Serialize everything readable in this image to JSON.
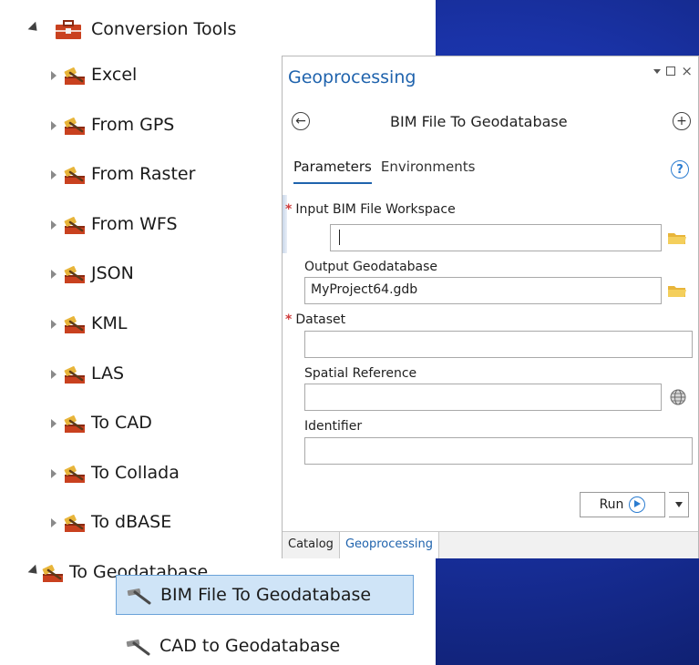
{
  "tree": {
    "root": {
      "label": "Conversion Tools"
    },
    "toolsets": [
      {
        "label": "Excel"
      },
      {
        "label": "From GPS"
      },
      {
        "label": "From Raster"
      },
      {
        "label": "From WFS"
      },
      {
        "label": "JSON"
      },
      {
        "label": "KML"
      },
      {
        "label": "LAS"
      },
      {
        "label": "To CAD"
      },
      {
        "label": "To Collada"
      },
      {
        "label": "To dBASE"
      },
      {
        "label": "To Geodatabase"
      }
    ],
    "tools": [
      {
        "label": "BIM File To Geodatabase",
        "selected": true
      },
      {
        "label": "CAD to Geodatabase",
        "selected": false
      }
    ]
  },
  "pane": {
    "title": "Geoprocessing",
    "tool_name": "BIM File To Geodatabase",
    "tabs": [
      {
        "label": "Parameters",
        "active": true
      },
      {
        "label": "Environments",
        "active": false
      }
    ],
    "params": {
      "input_bim": {
        "label": "Input BIM File Workspace",
        "value": "",
        "required": true
      },
      "output_gdb": {
        "label": "Output Geodatabase",
        "value": "MyProject64.gdb",
        "required": false
      },
      "dataset": {
        "label": "Dataset",
        "value": "",
        "required": true
      },
      "spatial_ref": {
        "label": "Spatial Reference",
        "value": "",
        "required": false
      },
      "identifier": {
        "label": "Identifier",
        "value": "",
        "required": false
      }
    },
    "run_label": "Run",
    "bottom_tabs": [
      {
        "label": "Catalog",
        "active": false
      },
      {
        "label": "Geoprocessing",
        "active": true
      }
    ]
  },
  "colors": {
    "accent": "#1f63ad",
    "required": "#d03c3c",
    "background": "#1a33a8",
    "selection": "#cfe4f7"
  },
  "icons": {
    "toolset": "hammer-toolset-icon",
    "tool": "hammer-icon",
    "toolbox": "toolbox-icon",
    "browse": "folder-icon",
    "spatial_ref": "globe-icon",
    "help": "help-icon",
    "back": "back-arrow-icon",
    "add": "add-icon"
  }
}
